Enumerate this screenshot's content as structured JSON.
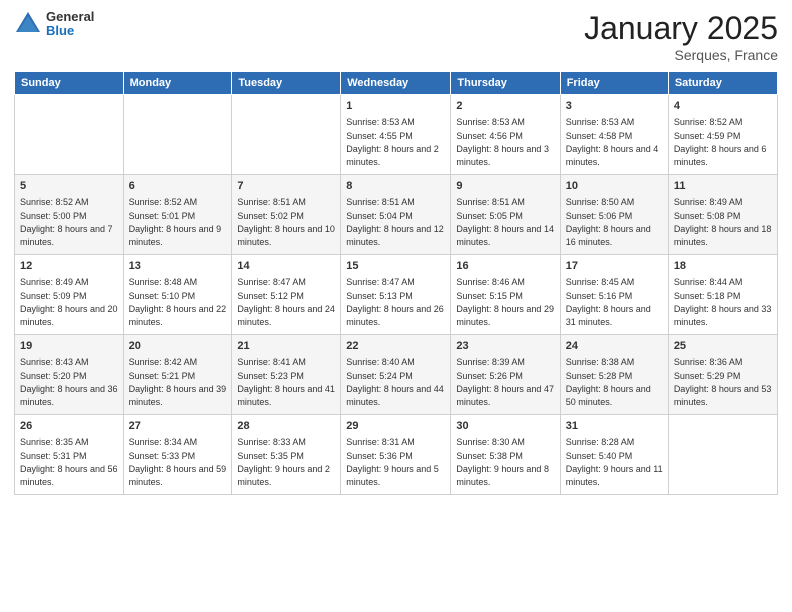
{
  "header": {
    "logo_general": "General",
    "logo_blue": "Blue",
    "month_title": "January 2025",
    "location": "Serques, France"
  },
  "weekdays": [
    "Sunday",
    "Monday",
    "Tuesday",
    "Wednesday",
    "Thursday",
    "Friday",
    "Saturday"
  ],
  "weeks": [
    [
      {
        "day": "",
        "sunrise": "",
        "sunset": "",
        "daylight": ""
      },
      {
        "day": "",
        "sunrise": "",
        "sunset": "",
        "daylight": ""
      },
      {
        "day": "",
        "sunrise": "",
        "sunset": "",
        "daylight": ""
      },
      {
        "day": "1",
        "sunrise": "Sunrise: 8:53 AM",
        "sunset": "Sunset: 4:55 PM",
        "daylight": "Daylight: 8 hours and 2 minutes."
      },
      {
        "day": "2",
        "sunrise": "Sunrise: 8:53 AM",
        "sunset": "Sunset: 4:56 PM",
        "daylight": "Daylight: 8 hours and 3 minutes."
      },
      {
        "day": "3",
        "sunrise": "Sunrise: 8:53 AM",
        "sunset": "Sunset: 4:58 PM",
        "daylight": "Daylight: 8 hours and 4 minutes."
      },
      {
        "day": "4",
        "sunrise": "Sunrise: 8:52 AM",
        "sunset": "Sunset: 4:59 PM",
        "daylight": "Daylight: 8 hours and 6 minutes."
      }
    ],
    [
      {
        "day": "5",
        "sunrise": "Sunrise: 8:52 AM",
        "sunset": "Sunset: 5:00 PM",
        "daylight": "Daylight: 8 hours and 7 minutes."
      },
      {
        "day": "6",
        "sunrise": "Sunrise: 8:52 AM",
        "sunset": "Sunset: 5:01 PM",
        "daylight": "Daylight: 8 hours and 9 minutes."
      },
      {
        "day": "7",
        "sunrise": "Sunrise: 8:51 AM",
        "sunset": "Sunset: 5:02 PM",
        "daylight": "Daylight: 8 hours and 10 minutes."
      },
      {
        "day": "8",
        "sunrise": "Sunrise: 8:51 AM",
        "sunset": "Sunset: 5:04 PM",
        "daylight": "Daylight: 8 hours and 12 minutes."
      },
      {
        "day": "9",
        "sunrise": "Sunrise: 8:51 AM",
        "sunset": "Sunset: 5:05 PM",
        "daylight": "Daylight: 8 hours and 14 minutes."
      },
      {
        "day": "10",
        "sunrise": "Sunrise: 8:50 AM",
        "sunset": "Sunset: 5:06 PM",
        "daylight": "Daylight: 8 hours and 16 minutes."
      },
      {
        "day": "11",
        "sunrise": "Sunrise: 8:49 AM",
        "sunset": "Sunset: 5:08 PM",
        "daylight": "Daylight: 8 hours and 18 minutes."
      }
    ],
    [
      {
        "day": "12",
        "sunrise": "Sunrise: 8:49 AM",
        "sunset": "Sunset: 5:09 PM",
        "daylight": "Daylight: 8 hours and 20 minutes."
      },
      {
        "day": "13",
        "sunrise": "Sunrise: 8:48 AM",
        "sunset": "Sunset: 5:10 PM",
        "daylight": "Daylight: 8 hours and 22 minutes."
      },
      {
        "day": "14",
        "sunrise": "Sunrise: 8:47 AM",
        "sunset": "Sunset: 5:12 PM",
        "daylight": "Daylight: 8 hours and 24 minutes."
      },
      {
        "day": "15",
        "sunrise": "Sunrise: 8:47 AM",
        "sunset": "Sunset: 5:13 PM",
        "daylight": "Daylight: 8 hours and 26 minutes."
      },
      {
        "day": "16",
        "sunrise": "Sunrise: 8:46 AM",
        "sunset": "Sunset: 5:15 PM",
        "daylight": "Daylight: 8 hours and 29 minutes."
      },
      {
        "day": "17",
        "sunrise": "Sunrise: 8:45 AM",
        "sunset": "Sunset: 5:16 PM",
        "daylight": "Daylight: 8 hours and 31 minutes."
      },
      {
        "day": "18",
        "sunrise": "Sunrise: 8:44 AM",
        "sunset": "Sunset: 5:18 PM",
        "daylight": "Daylight: 8 hours and 33 minutes."
      }
    ],
    [
      {
        "day": "19",
        "sunrise": "Sunrise: 8:43 AM",
        "sunset": "Sunset: 5:20 PM",
        "daylight": "Daylight: 8 hours and 36 minutes."
      },
      {
        "day": "20",
        "sunrise": "Sunrise: 8:42 AM",
        "sunset": "Sunset: 5:21 PM",
        "daylight": "Daylight: 8 hours and 39 minutes."
      },
      {
        "day": "21",
        "sunrise": "Sunrise: 8:41 AM",
        "sunset": "Sunset: 5:23 PM",
        "daylight": "Daylight: 8 hours and 41 minutes."
      },
      {
        "day": "22",
        "sunrise": "Sunrise: 8:40 AM",
        "sunset": "Sunset: 5:24 PM",
        "daylight": "Daylight: 8 hours and 44 minutes."
      },
      {
        "day": "23",
        "sunrise": "Sunrise: 8:39 AM",
        "sunset": "Sunset: 5:26 PM",
        "daylight": "Daylight: 8 hours and 47 minutes."
      },
      {
        "day": "24",
        "sunrise": "Sunrise: 8:38 AM",
        "sunset": "Sunset: 5:28 PM",
        "daylight": "Daylight: 8 hours and 50 minutes."
      },
      {
        "day": "25",
        "sunrise": "Sunrise: 8:36 AM",
        "sunset": "Sunset: 5:29 PM",
        "daylight": "Daylight: 8 hours and 53 minutes."
      }
    ],
    [
      {
        "day": "26",
        "sunrise": "Sunrise: 8:35 AM",
        "sunset": "Sunset: 5:31 PM",
        "daylight": "Daylight: 8 hours and 56 minutes."
      },
      {
        "day": "27",
        "sunrise": "Sunrise: 8:34 AM",
        "sunset": "Sunset: 5:33 PM",
        "daylight": "Daylight: 8 hours and 59 minutes."
      },
      {
        "day": "28",
        "sunrise": "Sunrise: 8:33 AM",
        "sunset": "Sunset: 5:35 PM",
        "daylight": "Daylight: 9 hours and 2 minutes."
      },
      {
        "day": "29",
        "sunrise": "Sunrise: 8:31 AM",
        "sunset": "Sunset: 5:36 PM",
        "daylight": "Daylight: 9 hours and 5 minutes."
      },
      {
        "day": "30",
        "sunrise": "Sunrise: 8:30 AM",
        "sunset": "Sunset: 5:38 PM",
        "daylight": "Daylight: 9 hours and 8 minutes."
      },
      {
        "day": "31",
        "sunrise": "Sunrise: 8:28 AM",
        "sunset": "Sunset: 5:40 PM",
        "daylight": "Daylight: 9 hours and 11 minutes."
      },
      {
        "day": "",
        "sunrise": "",
        "sunset": "",
        "daylight": ""
      }
    ]
  ]
}
